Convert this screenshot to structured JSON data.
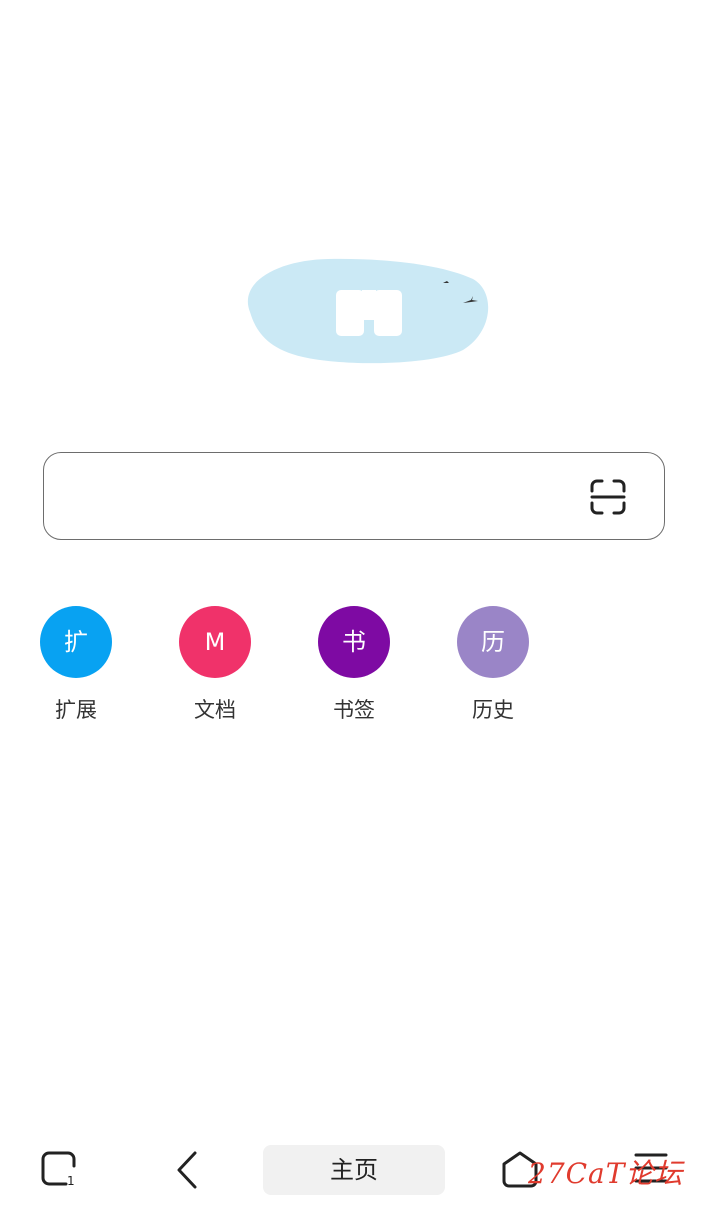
{
  "search": {
    "value": "",
    "placeholder": ""
  },
  "quick_access": [
    {
      "icon_text": "扩",
      "label": "扩展",
      "color": "#08a2f2"
    },
    {
      "icon_text": "M",
      "label": "文档",
      "color": "#f0326a"
    },
    {
      "icon_text": "书",
      "label": "书签",
      "color": "#7e0aa3"
    },
    {
      "icon_text": "历",
      "label": "历史",
      "color": "#9a85c7"
    }
  ],
  "bottom_nav": {
    "tab_count": "1",
    "home_label": "主页"
  },
  "watermark": "27CaT论坛",
  "colors": {
    "logo_blob": "#cbe9f5",
    "search_border": "#6d6d6d",
    "home_pill_bg": "#f1f1f1",
    "watermark": "#e03b2e"
  },
  "icons": {
    "logo": "cloud-blob-logo",
    "scan": "scan-icon",
    "tabs": "tabs-icon",
    "back": "back-chevron-icon",
    "home": "home-hexagon-icon",
    "menu": "menu-icon"
  }
}
